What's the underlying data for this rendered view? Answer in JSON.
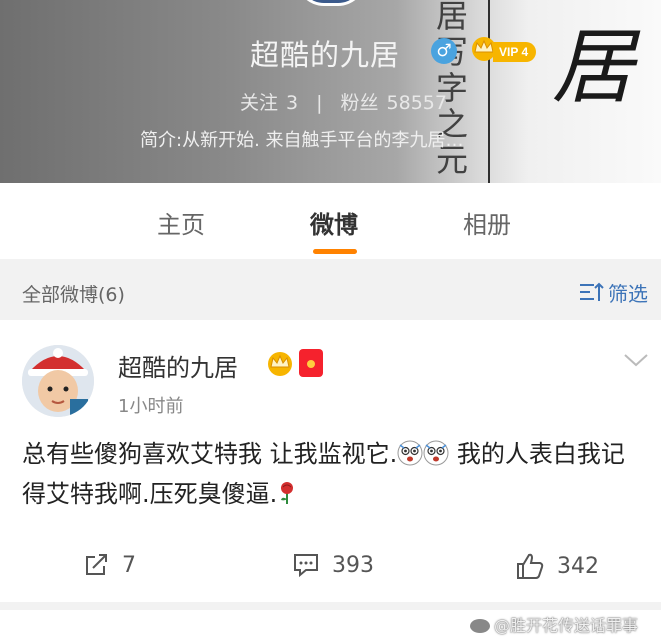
{
  "profile": {
    "nickname": "超酷的九居",
    "gender_icon": "male-icon",
    "vip_label": "VIP 4",
    "following_label": "关注",
    "following_count": "3",
    "separator": "|",
    "fans_label": "粉丝",
    "fans_count": "58557",
    "bio": "简介:从新开始. 来自触手平台的李九居…",
    "background_big_glyph": "居",
    "background_column_text": "居写字之元"
  },
  "tabs": [
    {
      "label": "主页",
      "active": false
    },
    {
      "label": "微博",
      "active": true
    },
    {
      "label": "相册",
      "active": false
    }
  ],
  "accent_color": "#ff8200",
  "link_color": "#3d74b8",
  "filter_bar": {
    "all_label": "全部微博(6)",
    "filter_label": "筛选"
  },
  "post": {
    "author": "超酷的九居",
    "time": "1小时前",
    "text_part1": "总有些傻狗喜欢艾特我 让我监视它.",
    "text_part2": " 我的人表白我记得艾特我啊.压死臭傻逼.",
    "emoji_icon": "shocked-face-icon",
    "rose_icon": "rose-icon",
    "reposts": "7",
    "comments": "393",
    "likes": "342"
  },
  "watermark": "@胜开花传送话罪事"
}
